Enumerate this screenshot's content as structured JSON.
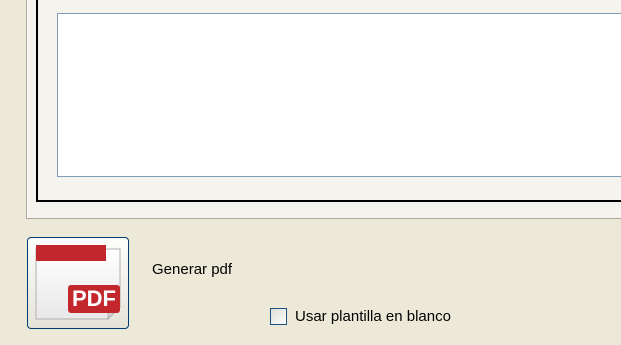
{
  "pdf_button": {
    "icon": "pdf-file-icon",
    "icon_text": "PDF",
    "brand_color": "#c1272d"
  },
  "generate_label": "Generar pdf",
  "blank_template": {
    "label": "Usar plantilla en blanco",
    "checked": false
  }
}
